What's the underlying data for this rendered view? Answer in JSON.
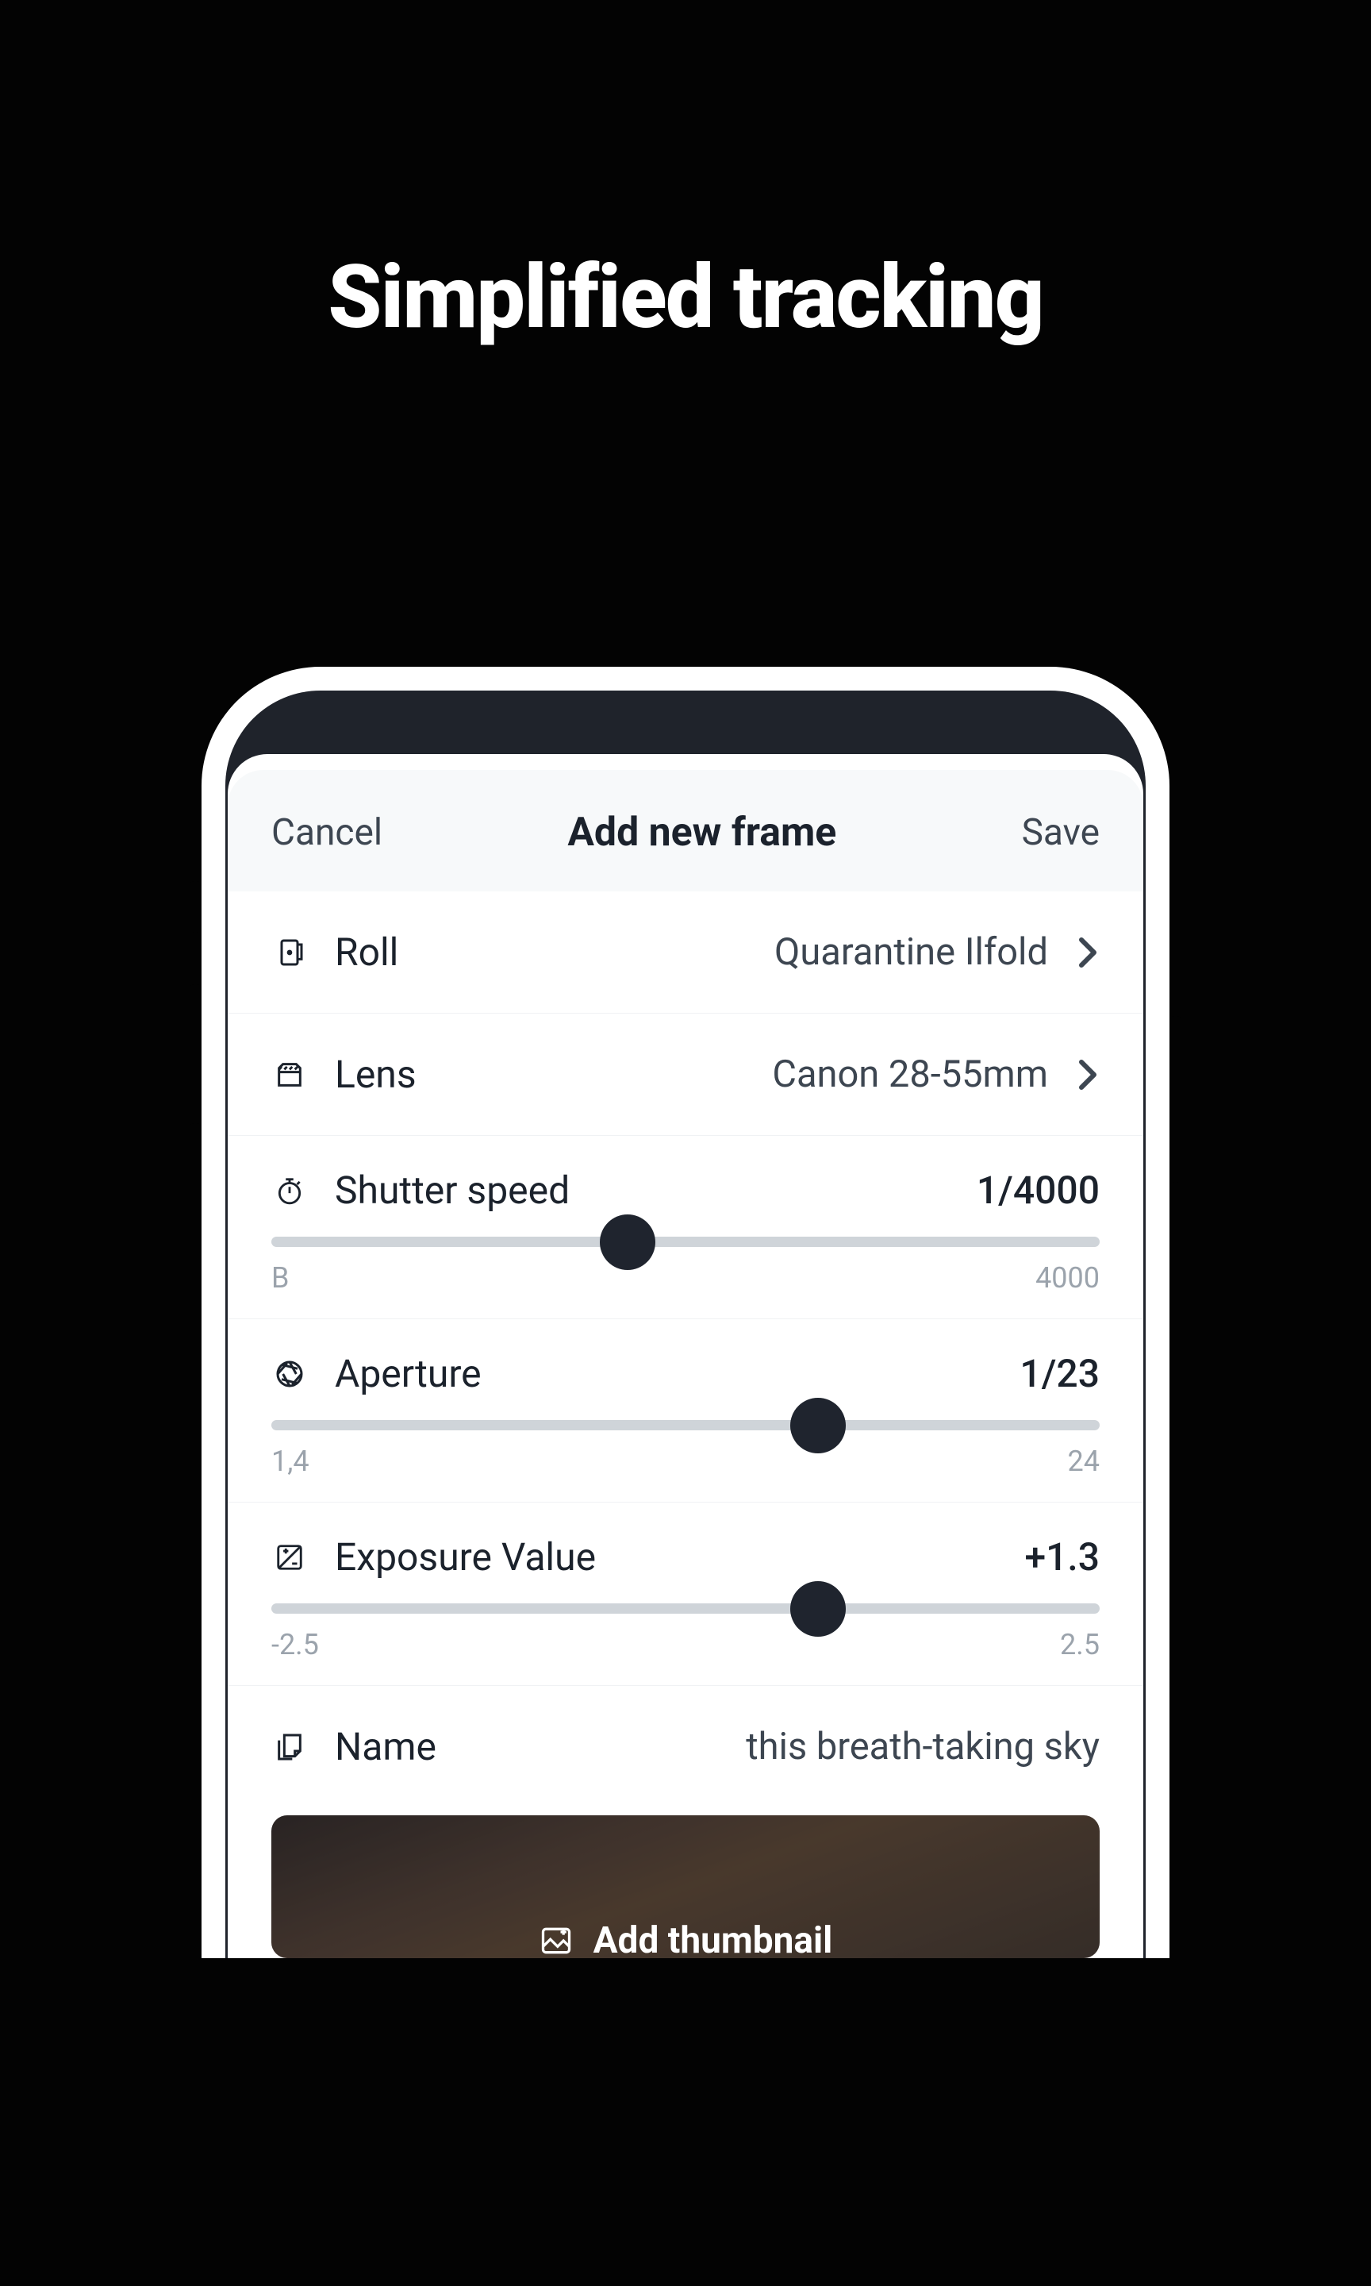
{
  "page": {
    "title": "Simplified tracking"
  },
  "modal": {
    "cancel_label": "Cancel",
    "title": "Add new frame",
    "save_label": "Save"
  },
  "fields": {
    "roll": {
      "label": "Roll",
      "value": "Quarantine Ilfold"
    },
    "lens": {
      "label": "Lens",
      "value": "Canon 28-55mm"
    },
    "shutter": {
      "label": "Shutter speed",
      "value": "1/4000",
      "min": "B",
      "max": "4000",
      "thumb_percent": 43
    },
    "aperture": {
      "label": "Aperture",
      "value": "1/23",
      "min": "1,4",
      "max": "24",
      "thumb_percent": 66
    },
    "exposure": {
      "label": "Exposure Value",
      "value": "+1.3",
      "min": "-2.5",
      "max": "2.5",
      "thumb_percent": 66
    },
    "name": {
      "label": "Name",
      "value": "this breath-taking sky"
    },
    "thumbnail": {
      "label": "Add thumbnail"
    }
  }
}
